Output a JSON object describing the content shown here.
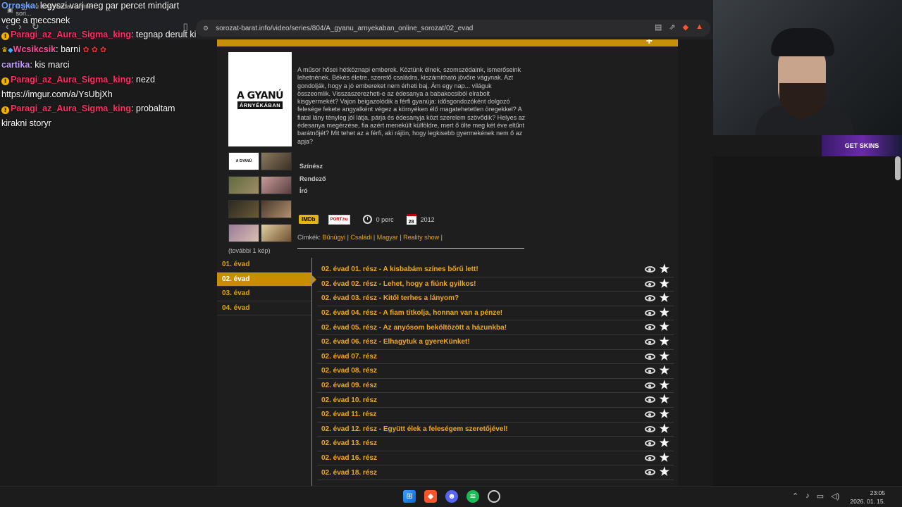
{
  "browser": {
    "tab_title": "A gyanú árnyékában online sori...",
    "url": "sorozat-barat.info/video/series/804/A_gyanu_arnyekaban_online_sorozat/02_evad"
  },
  "chat": {
    "messages": [
      {
        "user": "Orroska",
        "text": ": legyszi varj meg par percet mindjart vege a meccsnek"
      },
      {
        "user": "Paragi_az_Aura_Sigma_king",
        "text": ": tegnap derult ki"
      },
      {
        "user": "Wcsikcsik",
        "text": ": barni"
      },
      {
        "user": "cartika",
        "text": ": kis marci"
      },
      {
        "user": "Paragi_az_Aura_Sigma_king",
        "text": ": nezd"
      },
      {
        "user": "",
        "text": "https://imgur.com/a/YsUbjXh"
      },
      {
        "user": "Paragi_az_Aura_Sigma_king",
        "text": ": probaltam kirakni storyr"
      }
    ]
  },
  "show": {
    "poster_title": "A GYANÚ",
    "poster_subtitle": "ÁRNYÉKÁBAN",
    "description": "A műsor hősei hétköznapi emberek. Köztünk élnek, szomszédaink, ismerőseink lehetnének. Békés életre, szerető családra, kiszámítható jövőre vágynak. Azt gondolják, hogy a jó embereket nem érheti baj. Ám egy nap... világuk összeomlik. Visszaszerezheti-e az édesanya a babakocsiból elrabolt kisgyermekét? Vajon beigazolódik a férfi gyanúja: idősgondozóként dolgozó felesége fekete angyalként végez a környéken élő magatehetetlen öregekkel? A fiatal lány tényleg jól látja, párja és édesanyja közt szerelem szövődik? Helyes az édesanya megérzése, fia azért menekült külföldre, mert ő ölte meg két éve eltűnt barátnőjét? Mit tehet az a férfi, aki rájön, hogy legkisebb gyermekének nem ő az apja?",
    "more_images": "(további 1 kép)",
    "crew": {
      "actor": "Színész",
      "director": "Rendező",
      "writer": "Író"
    },
    "imdb": "IMDb",
    "port": "PORT.hu",
    "duration": "0 perc",
    "calendar_day": "28",
    "year": "2012",
    "tags_label": "Címkék:",
    "tags": [
      "Bűnügyi",
      "Családi",
      "Magyar",
      "Reality show"
    ]
  },
  "seasons": [
    "01. évad",
    "02. évad",
    "03. évad",
    "04. évad"
  ],
  "episodes": [
    "02. évad 01. rész - A kisbabám színes bőrű lett!",
    "02. évad 02. rész - Lehet, hogy a fiúnk gyilkos!",
    "02. évad 03. rész - Kitől terhes a lányom?",
    "02. évad 04. rész - A fiam titkolja, honnan van a pénze!",
    "02. évad 05. rész - Az anyósom beköltözött a házunkba!",
    "02. évad 06. rész - Elhagytuk a gyereKünket!",
    "02. évad 07. rész",
    "02. évad 08. rész",
    "02. évad 09. rész",
    "02. évad 10. rész",
    "02. évad 11. rész",
    "02. évad 12. rész - Együtt élek a feleségem szeretőjével!",
    "02. évad 13. rész",
    "02. évad 16. rész",
    "02. évad 18. rész"
  ],
  "overlay": {
    "get_skins": "GET SKINS"
  },
  "taskbar": {
    "time": "23:05",
    "date": "2026. 01. 15."
  }
}
